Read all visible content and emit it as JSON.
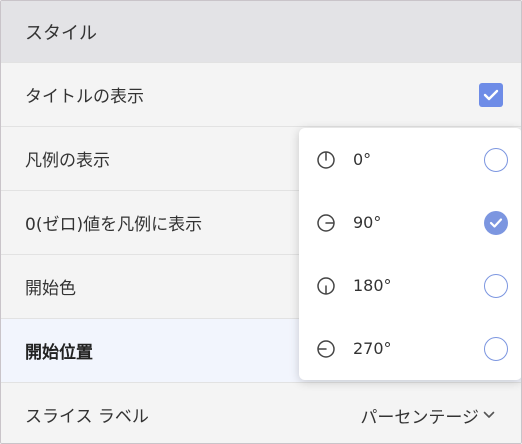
{
  "panel": {
    "section_title": "スタイル",
    "rows": [
      {
        "label": "タイトルの表示",
        "control": "checkbox",
        "checked": true
      },
      {
        "label": "凡例の表示"
      },
      {
        "label": "0(ゼロ)値を凡例に表示"
      },
      {
        "label": "開始色"
      },
      {
        "label": "開始位置",
        "highlighted": true
      },
      {
        "label": "スライス ラベル",
        "value": "パーセンテージ"
      }
    ],
    "accent_color": "#6e8ce7"
  },
  "start_position_menu": {
    "options": [
      {
        "label": "0°",
        "icon": "rotation-0-icon",
        "selected": false
      },
      {
        "label": "90°",
        "icon": "rotation-90-icon",
        "selected": true
      },
      {
        "label": "180°",
        "icon": "rotation-180-icon",
        "selected": false
      },
      {
        "label": "270°",
        "icon": "rotation-270-icon",
        "selected": false
      }
    ]
  }
}
